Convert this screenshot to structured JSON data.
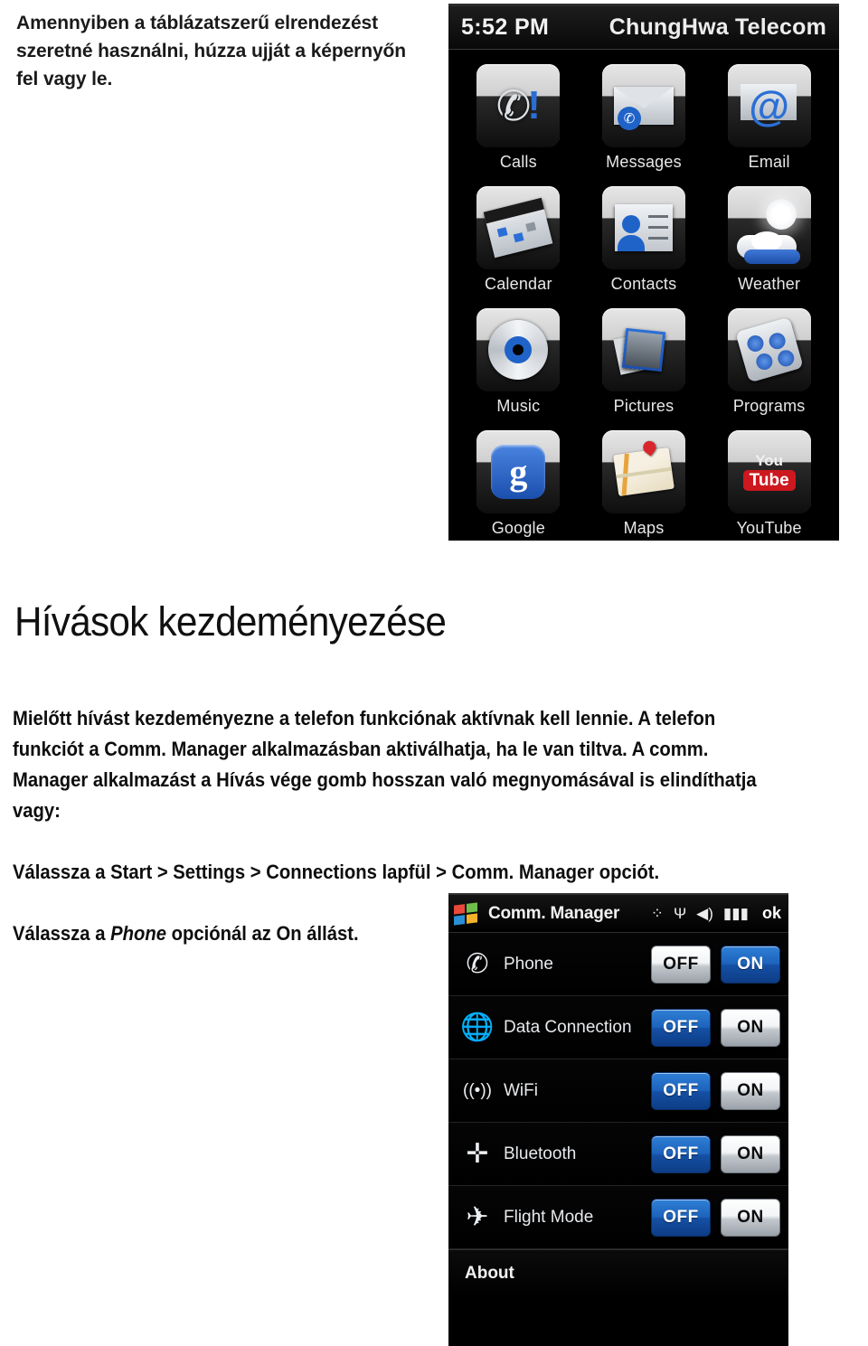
{
  "document": {
    "intro_paragraph": "Amennyiben a táblázatszerű elrendezést szeretné használni, húzza ujját a képernyőn fel vagy le.",
    "section_heading": "Hívások kezdeményezése",
    "paragraph_1_part1": "Mielőtt hívást kezdeményezne a telefon funkciónak aktívnak kell lennie. A telefon funkciót a Comm. Manager alkalmazásban aktiválhatja, ha le van tiltva. A comm. Manager alkalmazást a Hívás vége gomb hosszan való megnyomásával is elindíthatja vagy:",
    "paragraph_2": "Válassza a Start > Settings > Connections lapfül > Comm. Manager opciót.",
    "paragraph_3_pre": "Válassza a ",
    "paragraph_3_italic": "Phone",
    "paragraph_3_mid": " opciónál az ",
    "paragraph_3_bold": "On",
    "paragraph_3_post": " állást."
  },
  "home_screen": {
    "status": {
      "time": "5:52 PM",
      "carrier": "ChungHwa Telecom"
    },
    "apps": [
      {
        "label": "Calls",
        "icon": "calls-icon"
      },
      {
        "label": "Messages",
        "icon": "messages-icon"
      },
      {
        "label": "Email",
        "icon": "email-icon"
      },
      {
        "label": "Calendar",
        "icon": "calendar-icon"
      },
      {
        "label": "Contacts",
        "icon": "contacts-icon"
      },
      {
        "label": "Weather",
        "icon": "weather-icon"
      },
      {
        "label": "Music",
        "icon": "music-icon"
      },
      {
        "label": "Pictures",
        "icon": "pictures-icon"
      },
      {
        "label": "Programs",
        "icon": "programs-icon"
      },
      {
        "label": "Google",
        "icon": "google-icon"
      },
      {
        "label": "Maps",
        "icon": "maps-icon"
      },
      {
        "label": "YouTube",
        "icon": "youtube-icon"
      }
    ],
    "google_glyph": "g",
    "youtube_top": "You",
    "youtube_bottom": "Tube"
  },
  "comm_manager": {
    "titlebar": {
      "title": "Comm. Manager",
      "ok_label": "ok",
      "icons": [
        "sync-off-icon",
        "signal-icon",
        "speaker-icon",
        "battery-icon"
      ],
      "sync_glyph": "⁘",
      "signal_glyph": "Ψ",
      "speaker_glyph": "◀)",
      "battery_glyph": "▮▮▮"
    },
    "rows": [
      {
        "label": "Phone",
        "icon": "phone-icon",
        "glyph": "✆",
        "off_label": "OFF",
        "on_label": "ON",
        "active": "ON"
      },
      {
        "label": "Data Connection",
        "icon": "data-globe-icon",
        "glyph": "🌐",
        "off_label": "OFF",
        "on_label": "ON",
        "active": "OFF"
      },
      {
        "label": "WiFi",
        "icon": "wifi-icon",
        "glyph": "((•))",
        "off_label": "OFF",
        "on_label": "ON",
        "active": "OFF"
      },
      {
        "label": "Bluetooth",
        "icon": "bluetooth-icon",
        "glyph": "✛",
        "off_label": "OFF",
        "on_label": "ON",
        "active": "OFF"
      },
      {
        "label": "Flight Mode",
        "icon": "airplane-icon",
        "glyph": "✈",
        "off_label": "OFF",
        "on_label": "ON",
        "active": "OFF"
      }
    ],
    "bottom_bar": {
      "about_label": "About"
    }
  },
  "colors": {
    "active_blue": "#1d63bb",
    "screen_black": "#000000",
    "label_white": "#e7eaed",
    "google_blue": "#2b6fd6",
    "youtube_red": "#cc181e"
  }
}
